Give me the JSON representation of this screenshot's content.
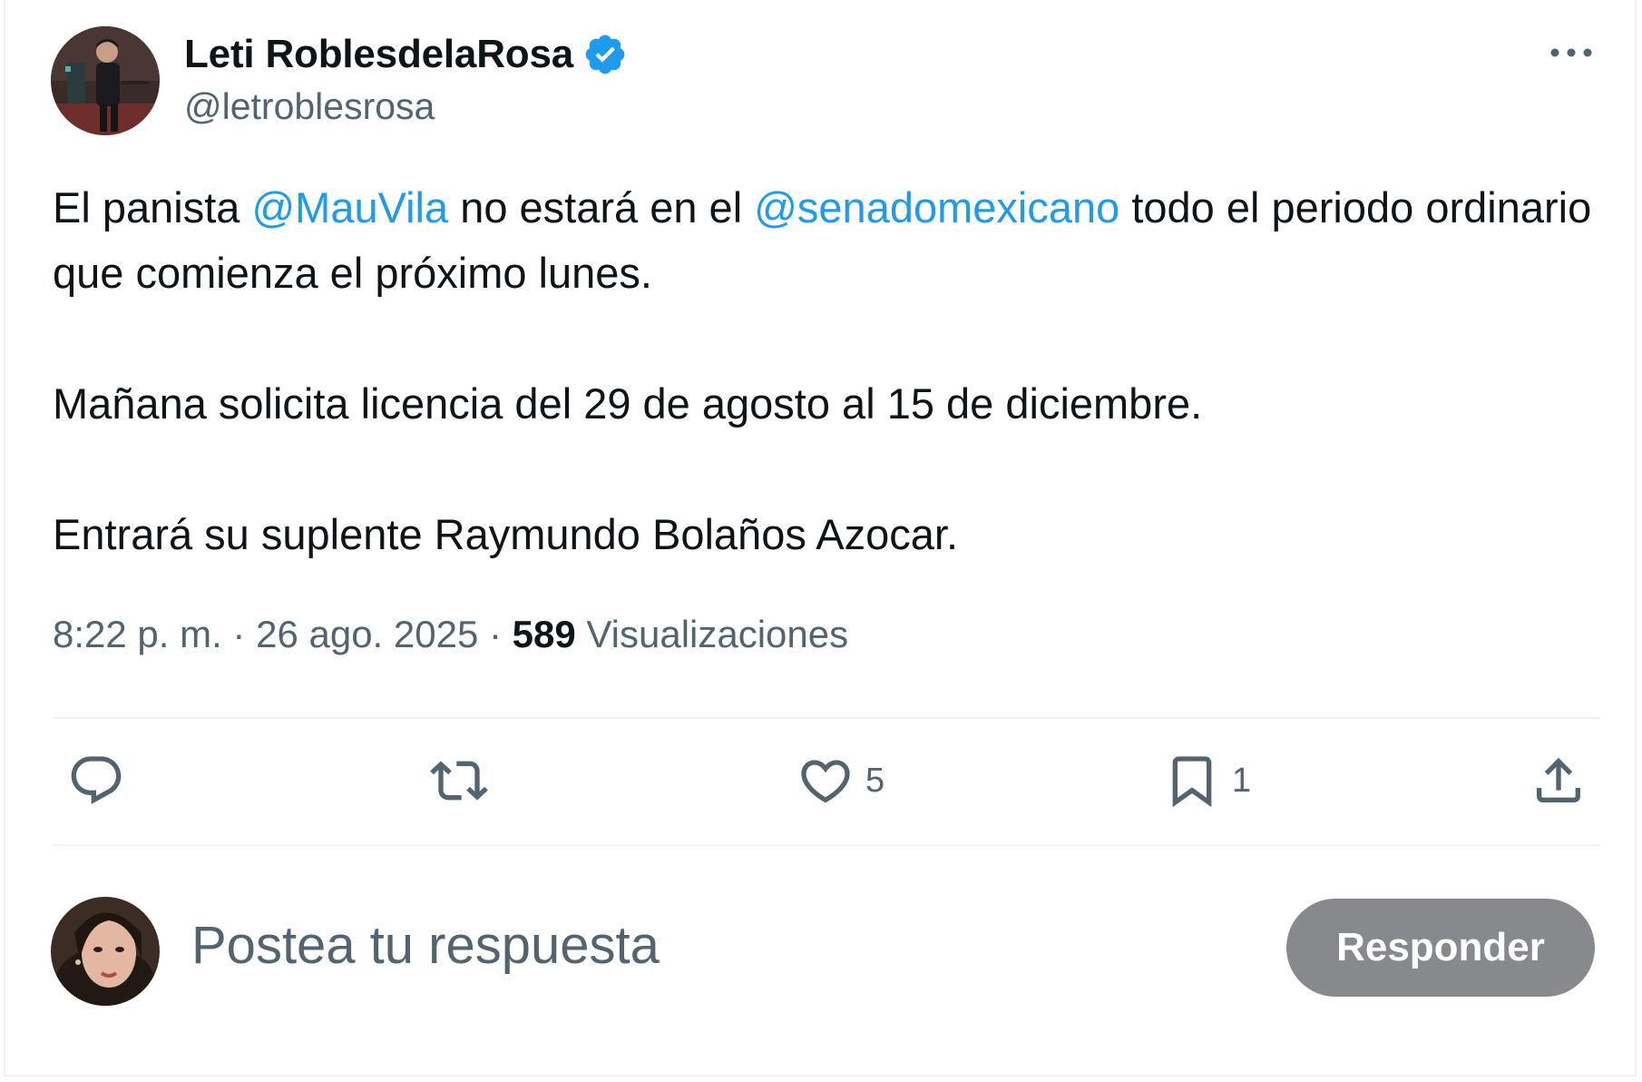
{
  "author": {
    "display_name": "Leti RoblesdelaRosa",
    "handle": "@letroblesrosa",
    "verified": true
  },
  "tweet": {
    "paragraph1": {
      "part1": "El panista ",
      "mention1": "@MauVila",
      "part2": " no estará en el ",
      "mention2": "@senadomexicano",
      "part3": " todo el periodo ordinario que comienza el próximo lunes."
    },
    "paragraph2": "Mañana solicita licencia del 29 de agosto al 15 de diciembre.",
    "paragraph3": "Entrará su suplente Raymundo Bolaños Azocar."
  },
  "meta": {
    "time": "8:22 p. m.",
    "separator": " · ",
    "date": "26 ago. 2025",
    "views_count": "589",
    "views_label": "Visualizaciones"
  },
  "actions": {
    "likes": "5",
    "bookmarks": "1"
  },
  "reply": {
    "placeholder": "Postea tu respuesta",
    "button_label": "Responder"
  },
  "colors": {
    "accent": "#1d9bf0",
    "secondary_text": "#536471",
    "primary_text": "#0f1419",
    "reply_button_bg": "#87898c"
  },
  "icons": [
    "verified-badge-icon",
    "more-options-icon",
    "reply-icon",
    "retweet-icon",
    "like-icon",
    "bookmark-icon",
    "share-icon"
  ]
}
